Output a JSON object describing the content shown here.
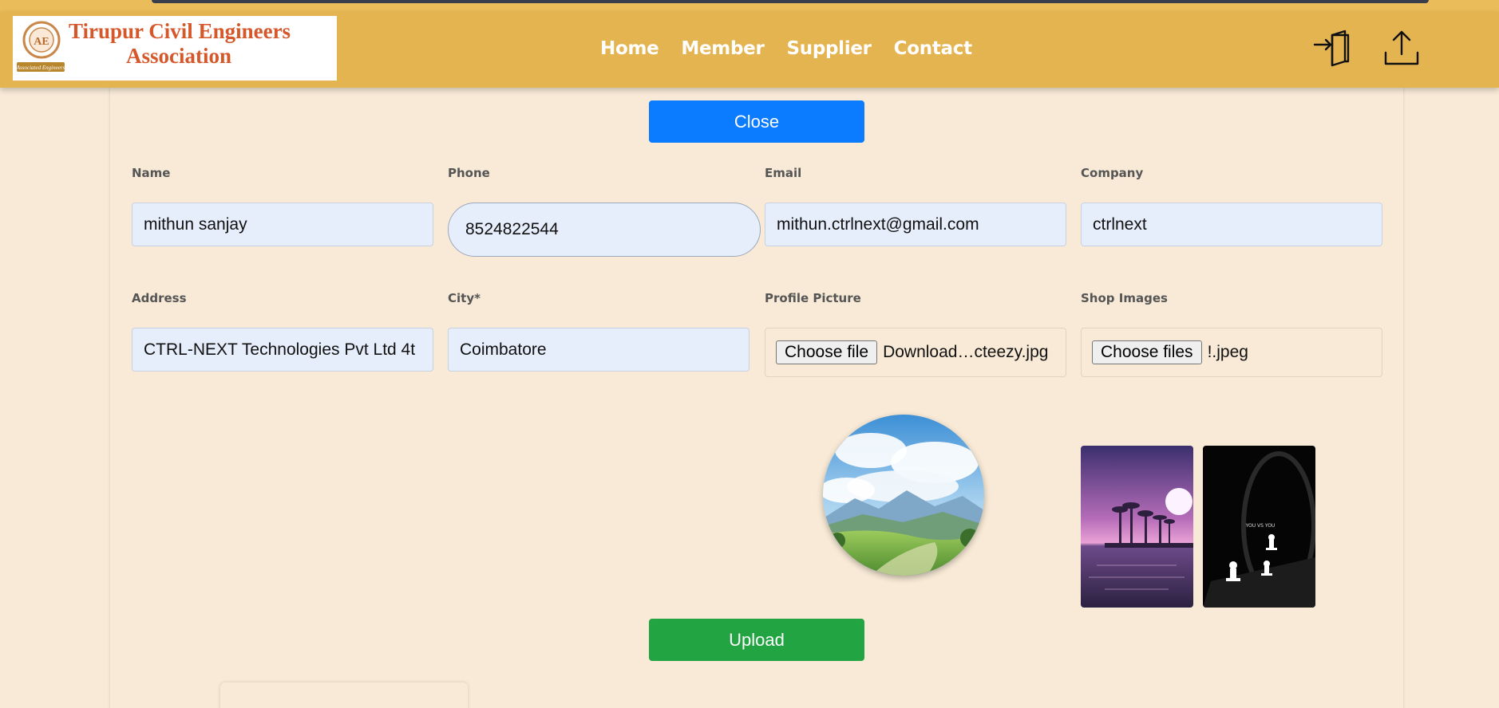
{
  "header": {
    "logo_line1": "Tirupur Civil Engineers",
    "logo_line2": "Association",
    "seal_text": "Associated Engineers"
  },
  "nav": {
    "items": [
      {
        "label": "Home"
      },
      {
        "label": "Member"
      },
      {
        "label": "Supplier"
      },
      {
        "label": "Contact"
      }
    ],
    "login_icon": "login-icon",
    "upload_icon": "upload-icon"
  },
  "form": {
    "close_label": "Close",
    "upload_label": "Upload",
    "name": {
      "label": "Name",
      "value": "mithun sanjay"
    },
    "phone": {
      "label": "Phone",
      "value": "8524822544"
    },
    "email": {
      "label": "Email",
      "value": "mithun.ctrlnext@gmail.com"
    },
    "company": {
      "label": "Company",
      "value": "ctrlnext"
    },
    "address": {
      "label": "Address",
      "value": "CTRL-NEXT Technologies Pvt Ltd 4t"
    },
    "city": {
      "label": "City*",
      "value": "Coimbatore"
    },
    "profile_picture": {
      "label": "Profile Picture",
      "button": "Choose file",
      "filename": "Download…cteezy.jpg"
    },
    "shop_images": {
      "label": "Shop Images",
      "button": "Choose files",
      "filename": "!.jpeg"
    }
  },
  "previews": {
    "shop_image_2_text": "YOU VS YOU"
  },
  "colors": {
    "navbar": "#e4b451",
    "background": "#f8ead6",
    "close_button": "#0b7bff",
    "upload_button": "#22a442",
    "input_bg": "#e6edfb",
    "logo_text": "#d5572a"
  }
}
